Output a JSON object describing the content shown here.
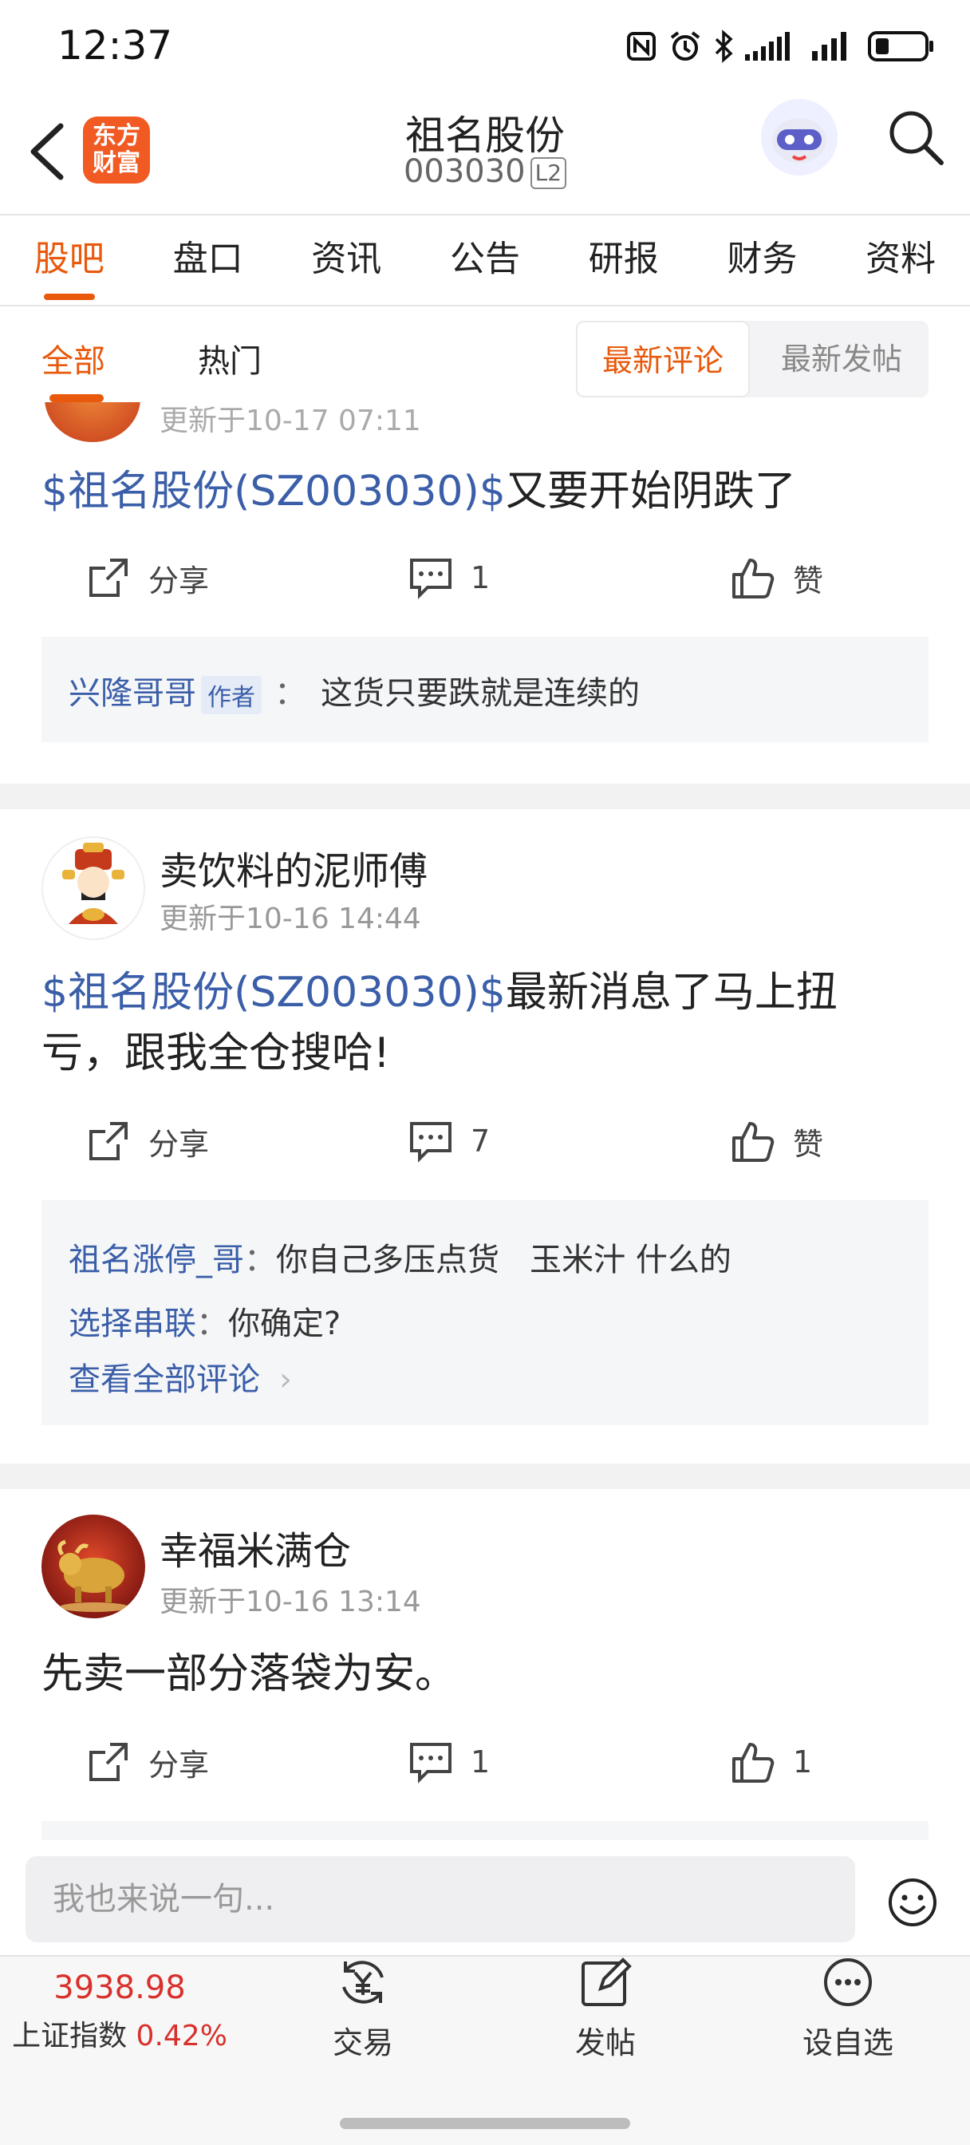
{
  "status_bar": {
    "time": "12:37"
  },
  "header": {
    "logo_line1": "东方",
    "logo_line2": "财富",
    "title": "祖名股份",
    "code": "003030",
    "level_badge": "L2"
  },
  "tabs": [
    "股吧",
    "盘口",
    "资讯",
    "公告",
    "研报",
    "财务",
    "资料"
  ],
  "subtabs": {
    "all": "全部",
    "hot": "热门",
    "sort_latest_comment": "最新评论",
    "sort_latest_post": "最新发帖"
  },
  "posts": [
    {
      "time": "更新于10-17 07:11",
      "link": "$祖名股份(SZ003030)$",
      "text": "又要开始阴跌了",
      "share": "分享",
      "comments": "1",
      "likes": "赞",
      "replies": [
        {
          "user": "兴隆哥哥",
          "badge": "作者",
          "sep": "：",
          "text": "这货只要跌就是连续的"
        }
      ]
    },
    {
      "user": "卖饮料的泥师傅",
      "time": "更新于10-16 14:44",
      "link": "$祖名股份(SZ003030)$",
      "text_line1": "最新消息了马上扭",
      "text_line2": "亏，跟我全仓搜哈!",
      "share": "分享",
      "comments": "7",
      "likes": "赞",
      "replies": [
        {
          "user": "祖名涨停_哥",
          "sep": "：",
          "text": "你自己多压点货   玉米汁 什么的"
        },
        {
          "user": "选择串联",
          "sep": "：",
          "text": "你确定?"
        }
      ],
      "view_all": "查看全部评论"
    },
    {
      "user": "幸福米满仓",
      "time": "更新于10-16 13:14",
      "text": "先卖一部分落袋为安。",
      "share": "分享",
      "comments": "1",
      "likes": "1"
    }
  ],
  "input_placeholder": "我也来说一句...",
  "bottom_nav": {
    "index_value": "3938.98",
    "index_name": "上证指数",
    "index_change": "0.42%",
    "trade": "交易",
    "post": "发帖",
    "watchlist": "设自选"
  },
  "colors": {
    "accent": "#e8590c",
    "link": "#3a5ea8",
    "red": "#d9302b"
  }
}
